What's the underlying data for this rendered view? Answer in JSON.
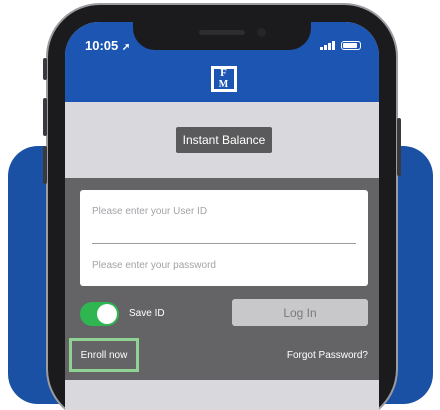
{
  "status_bar": {
    "time": "10:05"
  },
  "logo": {
    "top": "F",
    "bottom": "M"
  },
  "instant_balance": {
    "label": "Instant Balance"
  },
  "login_form": {
    "user_id_placeholder": "Please enter your User ID",
    "password_placeholder": "Please enter your password",
    "save_id_label": "Save ID",
    "save_id_on": true,
    "login_label": "Log In",
    "enroll_label": "Enroll now",
    "forgot_label": "Forgot Password?"
  },
  "colors": {
    "brand_blue": "#1c55b2",
    "toggle_green": "#2fb650",
    "highlight_green": "#8fd394"
  }
}
